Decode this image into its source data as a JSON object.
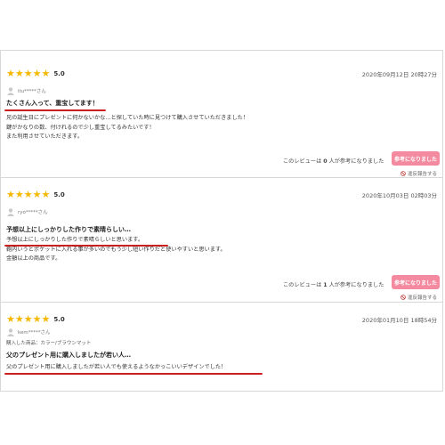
{
  "reviews": [
    {
      "stars": "★★★★★",
      "rating": "5.0",
      "date": "2020年09月12日 20時27分",
      "nickname": "itu*****さん",
      "title": "たくさん入って、重宝してます！",
      "body": [
        "兄の誕生日にプレゼントに何かないかな…と探していた時に見つけて購入させていただきました！",
        "鍵がかなりの数、付けれるので少し重宝してるみたいです！",
        "また利用させていただきます。"
      ],
      "helpful_prefix": "このレビューは",
      "helpful_count": "0",
      "helpful_suffix": "人が参考になりました",
      "helpful_button": "参考になりました",
      "report_label": "違反報告する"
    },
    {
      "stars": "★★★★★",
      "rating": "5.0",
      "date": "2020年10月03日 02時03分",
      "nickname": "ryo*****さん",
      "title": "予想以上にしっかりした作りで素晴らしい…",
      "body": [
        "予想以上にしっかりした作りで素晴らしいと思います。",
        "鞄内いうとポケットに入れる事が多いのでもう少し短い作りだと使いやすいと思います。",
        "金額以上の商品です。"
      ],
      "helpful_prefix": "このレビューは",
      "helpful_count": "1",
      "helpful_suffix": "人が参考になりました",
      "helpful_button": "参考になりました",
      "report_label": "違反報告する"
    },
    {
      "stars": "★★★★★",
      "rating": "5.0",
      "date": "2020年01月10日 18時54分",
      "nickname": "kem*****さん",
      "product": "購入した商品：カラー/ブラウンマット",
      "title": "父のプレゼント用に購入しましたが若い人…",
      "body": [
        "父のプレゼント用に購入しましたが若い人でも使えるようなかっこいいデザインでした！"
      ]
    }
  ]
}
